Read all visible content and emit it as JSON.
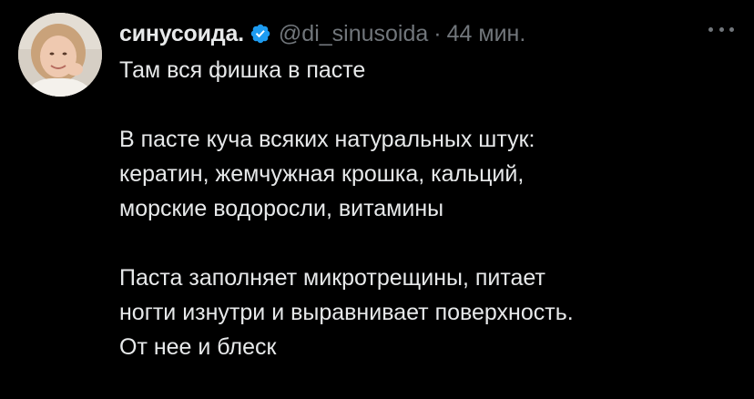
{
  "author": {
    "display_name": "синусоида.",
    "handle": "@di_sinusoida",
    "separator": "·",
    "time": "44 мин."
  },
  "tweet": {
    "lines": [
      "Там вся фишка в пасте",
      "",
      "В пасте куча всяких натуральных штук:",
      "кератин, жемчужная крошка, кальций,",
      "морские водоросли, витамины",
      "",
      "Паста заполняет микротрещины, питает",
      "ногти изнутри и выравнивает поверхность.",
      "От нее и блеск"
    ]
  },
  "icons": {
    "verified": "verified-badge-icon",
    "more": "more-options-icon"
  },
  "colors": {
    "background": "#000000",
    "text_primary": "#e7e9ea",
    "text_secondary": "#71767b",
    "verified_blue": "#1d9bf0"
  }
}
